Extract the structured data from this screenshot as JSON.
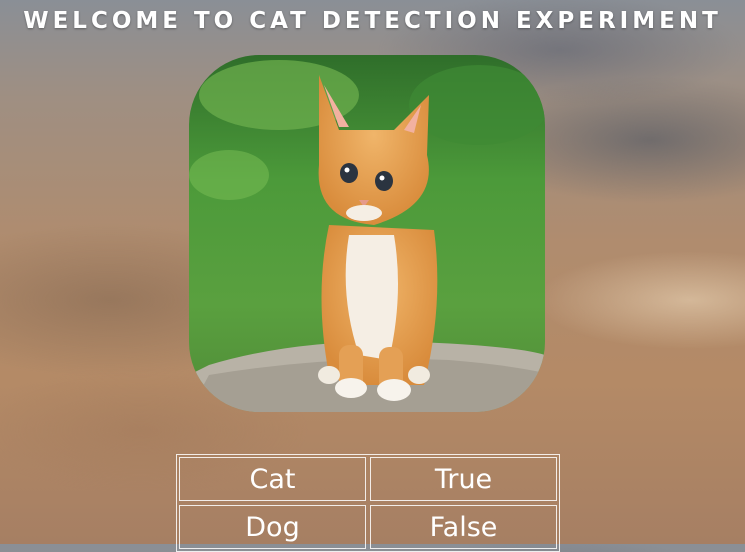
{
  "header": {
    "title": "WELCOME TO CAT DETECTION EXPERIMENT"
  },
  "image": {
    "subject": "kitten-photo"
  },
  "results": {
    "rows": [
      {
        "label": "Cat",
        "value": "True"
      },
      {
        "label": "Dog",
        "value": "False"
      }
    ]
  }
}
